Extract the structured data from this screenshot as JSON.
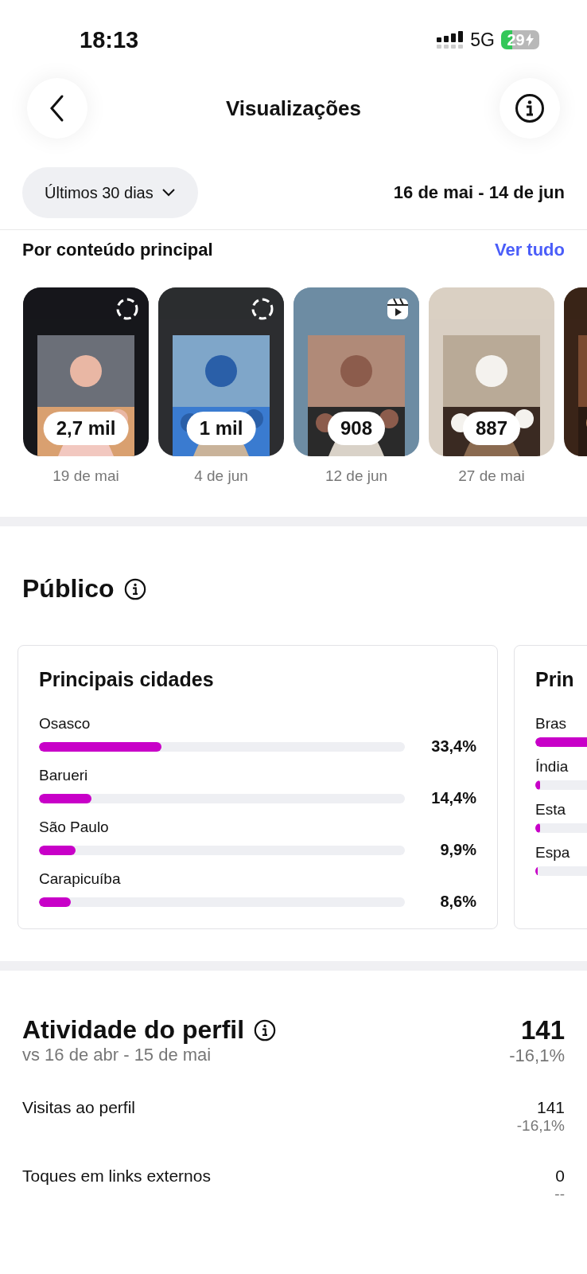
{
  "status_bar": {
    "time": "18:13",
    "network": "5G",
    "battery": "29"
  },
  "header": {
    "title": "Visualizações"
  },
  "filter": {
    "label": "Últimos 30 dias",
    "range": "16 de mai - 14 de jun"
  },
  "top_content": {
    "title": "Por conteúdo principal",
    "link": "Ver tudo",
    "items": [
      {
        "kind": "story",
        "count": "2,7 mil",
        "date": "19 de mai"
      },
      {
        "kind": "story",
        "count": "1 mil",
        "date": "4 de jun"
      },
      {
        "kind": "reel",
        "count": "908",
        "date": "12 de jun"
      },
      {
        "kind": "post",
        "count": "887",
        "date": "27 de mai"
      },
      {
        "kind": "post"
      }
    ]
  },
  "audience": {
    "title": "Público",
    "cards": [
      {
        "title": "Principais cidades",
        "rows": [
          {
            "name": "Osasco",
            "level": 0.334,
            "value": "33,4%"
          },
          {
            "name": "Barueri",
            "level": 0.144,
            "value": "14,4%"
          },
          {
            "name": "São Paulo",
            "level": 0.099,
            "value": "9,9%"
          },
          {
            "name": "Carapicuíba",
            "level": 0.086,
            "value": "8,6%"
          }
        ]
      },
      {
        "title": "Prin",
        "rows": [
          {
            "name": "Bras",
            "level": 0.9
          },
          {
            "name": "Índia",
            "level": 0.01
          },
          {
            "name": "Esta",
            "level": 0.01
          },
          {
            "name": "Espa",
            "level": 0.005
          }
        ]
      }
    ]
  },
  "activity": {
    "title": "Atividade do perfil",
    "compare": "vs 16 de abr - 15 de mai",
    "total": "141",
    "change": "-16,1%",
    "rows": [
      {
        "label": "Visitas ao perfil",
        "value": "141",
        "change": "-16,1%"
      },
      {
        "label": "Toques em links externos",
        "value": "0",
        "change": "--"
      }
    ]
  }
}
